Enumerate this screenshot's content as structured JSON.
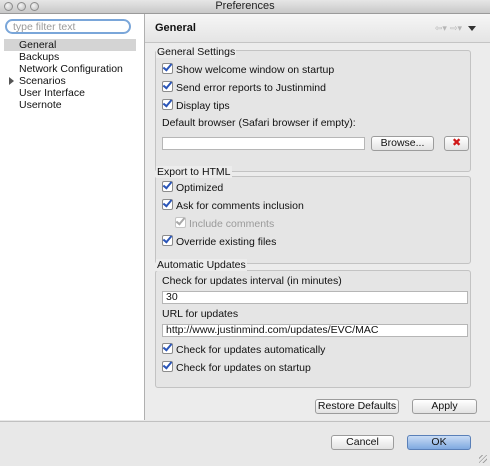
{
  "window": {
    "title": "Preferences"
  },
  "sidebar": {
    "filter_placeholder": "type filter text",
    "items": [
      {
        "label": "General",
        "selected": true,
        "expandable": false
      },
      {
        "label": "Backups",
        "selected": false,
        "expandable": false
      },
      {
        "label": "Network Configuration",
        "selected": false,
        "expandable": false
      },
      {
        "label": "Scenarios",
        "selected": false,
        "expandable": true
      },
      {
        "label": "User Interface",
        "selected": false,
        "expandable": false
      },
      {
        "label": "Usernote",
        "selected": false,
        "expandable": false
      }
    ]
  },
  "page": {
    "title": "General",
    "nav_icons": [
      "back-arrow-icon",
      "forward-arrow-icon",
      "view-menu-icon"
    ]
  },
  "general_settings": {
    "legend": "General Settings",
    "show_welcome": {
      "label": "Show welcome window on startup",
      "checked": true
    },
    "send_errors": {
      "label": "Send error reports to Justinmind",
      "checked": true
    },
    "display_tips": {
      "label": "Display tips",
      "checked": true
    },
    "browser_label": "Default browser (Safari browser if empty):",
    "browser_value": "",
    "browse_label": "Browse...",
    "clear_icon": "red-x-icon"
  },
  "export_html": {
    "legend": "Export to HTML",
    "optimized": {
      "label": "Optimized",
      "checked": true
    },
    "ask_comments": {
      "label": "Ask for comments inclusion",
      "checked": true
    },
    "include_comments": {
      "label": "Include comments",
      "checked": true,
      "disabled": true
    },
    "override_files": {
      "label": "Override existing files",
      "checked": true
    }
  },
  "auto_updates": {
    "legend": "Automatic Updates",
    "interval_label": "Check for updates interval (in minutes)",
    "interval_value": "30",
    "url_label": "URL for updates",
    "url_value": "http://www.justinmind.com/updates/EVC/MAC",
    "check_auto": {
      "label": "Check for updates automatically",
      "checked": true
    },
    "check_startup": {
      "label": "Check for updates on startup",
      "checked": true
    }
  },
  "actions": {
    "restore_defaults": "Restore Defaults",
    "apply": "Apply",
    "cancel": "Cancel",
    "ok": "OK"
  },
  "colors": {
    "accent": "#7aa6d9",
    "ok_button": "#7fa9e0",
    "clear_x": "#d01818"
  }
}
